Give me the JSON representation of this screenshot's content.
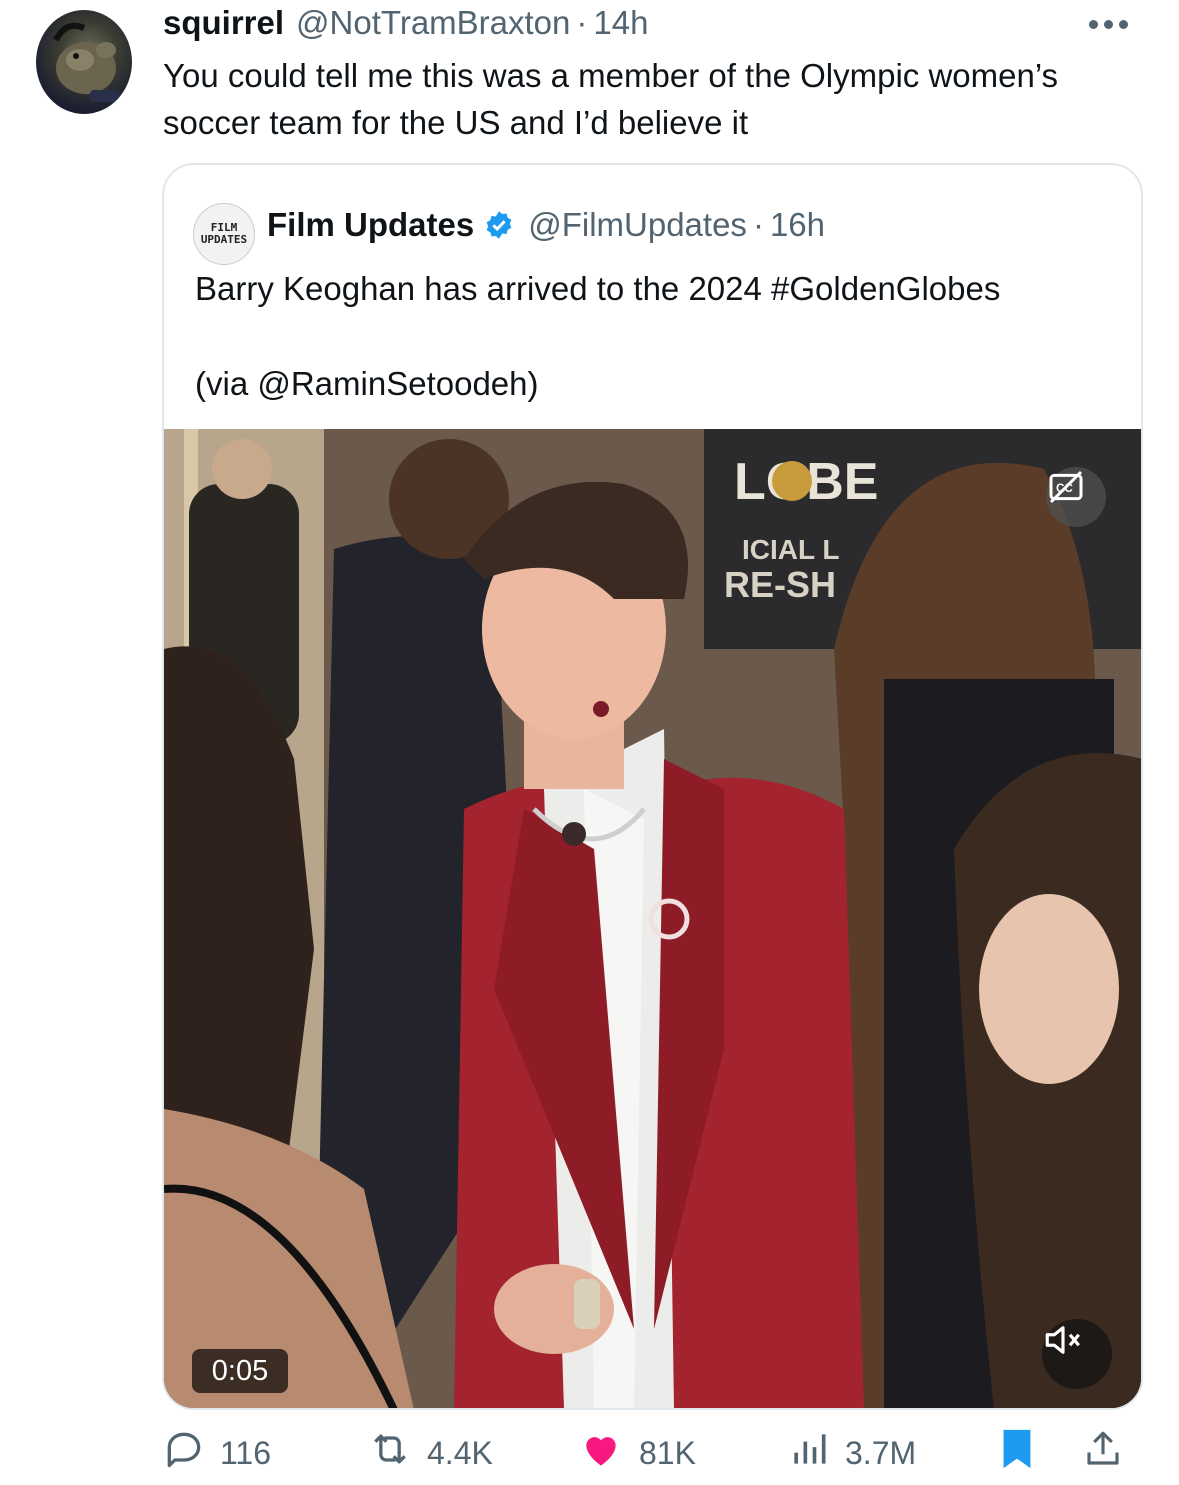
{
  "tweet": {
    "author_name": "squirrel",
    "author_handle": "@NotTramBraxton",
    "separator": "·",
    "time": "14h",
    "text": "You could tell me this was a member of the Olympic women’s soccer team for the US and I’d believe it"
  },
  "quote": {
    "avatar_text_line1": "FILM",
    "avatar_text_line2": "UPDATES",
    "author_name": "Film Updates",
    "author_handle": "@FilmUpdates",
    "separator": "·",
    "time": "16h",
    "text": "Barry Keoghan has arrived to the 2024 #GoldenGlobes",
    "via": "(via @RaminSetoodeh)",
    "video": {
      "timestamp": "0:05",
      "backdrop_letters_top": "LOBE",
      "backdrop_letters_mid": "ICIAL L",
      "backdrop_letters_bottom": "RE-SH"
    }
  },
  "actions": {
    "replies": "116",
    "reposts": "4.4K",
    "likes": "81K",
    "views": "3.7M"
  },
  "colors": {
    "text_primary": "#0f1419",
    "text_secondary": "#536471",
    "verified": "#1d9bf0",
    "like": "#f91880",
    "bookmark": "#1d9bf0"
  }
}
